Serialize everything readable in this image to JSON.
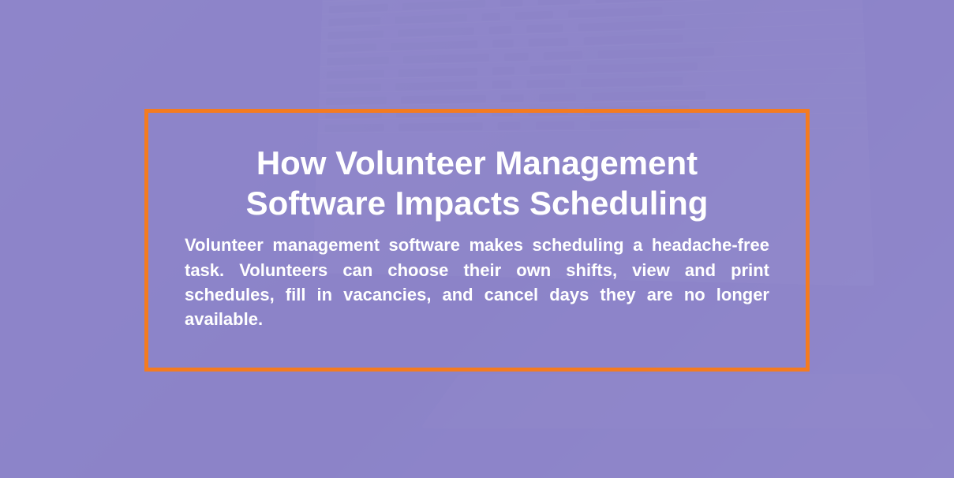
{
  "content": {
    "heading": "How Volunteer Management Software Impacts Scheduling",
    "body": "Volunteer management software makes scheduling a headache-free task. Volunteers can choose their own shifts, view and print schedules, fill in vacancies, and cancel days they are no longer available."
  },
  "colors": {
    "border": "#f47b20",
    "overlay": "#8b86c9",
    "text": "#ffffff"
  }
}
